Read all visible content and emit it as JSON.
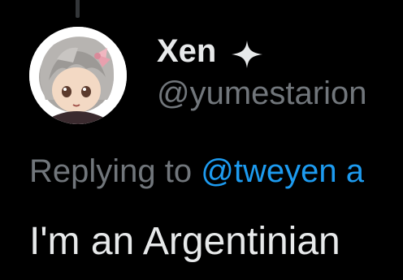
{
  "colors": {
    "background": "#000000",
    "primary_text": "#e7e9ea",
    "secondary_text": "#71767b",
    "link": "#1d9bf0"
  },
  "author": {
    "display_name": "Xen",
    "badge_icon": "four-point-star-icon",
    "handle": "@yumestarion",
    "avatar_icon": "avatar-grey-haired-figure"
  },
  "reply": {
    "prefix": "Replying to ",
    "mention": "@tweyen a"
  },
  "tweet": {
    "text": "I'm an Argentinian"
  }
}
